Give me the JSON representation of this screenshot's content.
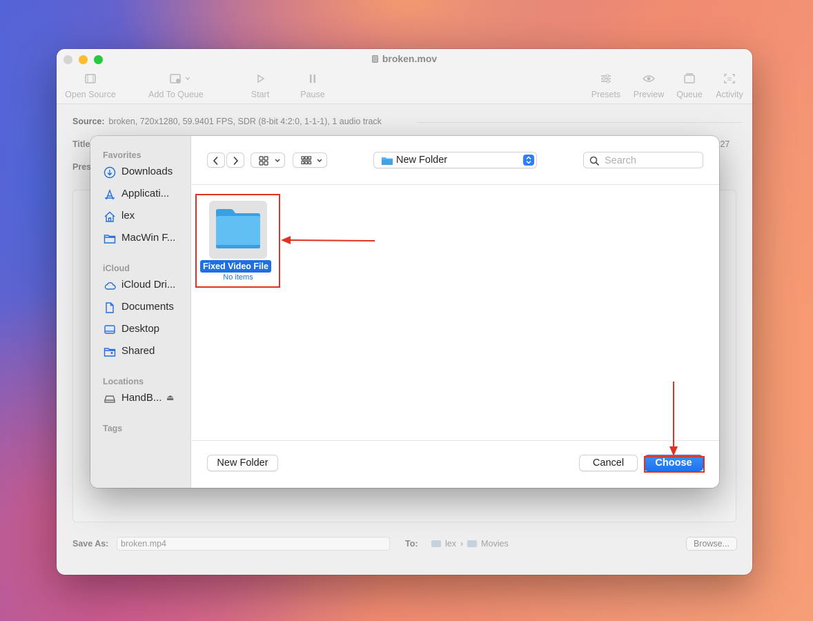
{
  "window": {
    "title": "broken.mov",
    "traffic_colors": [
      "#d4d4d4",
      "#febc2e",
      "#28c840"
    ],
    "toolbar": [
      {
        "label": "Open Source",
        "icon": "film-icon"
      },
      {
        "label": "Add To Queue",
        "icon": "add-queue-icon"
      },
      {
        "label": "Start",
        "icon": "play-icon"
      },
      {
        "label": "Pause",
        "icon": "pause-icon"
      },
      {
        "label": "Presets",
        "icon": "sliders-icon"
      },
      {
        "label": "Preview",
        "icon": "eye-icon"
      },
      {
        "label": "Queue",
        "icon": "queue-icon"
      },
      {
        "label": "Activity",
        "icon": "activity-icon"
      }
    ],
    "source_label": "Source:",
    "source_value": "broken, 720x1280, 59.9401 FPS, SDR (8-bit 4:2:0, 1-1-1), 1 audio track",
    "title_fragment": "Title",
    "presets_fragment": "Pres",
    "time_fragment": ":27",
    "save_as_label": "Save As:",
    "save_as_value": "broken.mp4",
    "to_label": "To:",
    "path": [
      "lex",
      "Movies"
    ],
    "browse_label": "Browse..."
  },
  "dialog": {
    "sidebar": {
      "favorites_head": "Favorites",
      "favorites": [
        {
          "label": "Downloads",
          "icon": "downloads-icon"
        },
        {
          "label": "Applicati...",
          "icon": "applications-icon"
        },
        {
          "label": "lex",
          "icon": "home-icon"
        },
        {
          "label": "MacWin F...",
          "icon": "folder-icon"
        }
      ],
      "icloud_head": "iCloud",
      "icloud": [
        {
          "label": "iCloud Dri...",
          "icon": "cloud-icon"
        },
        {
          "label": "Documents",
          "icon": "document-icon"
        },
        {
          "label": "Desktop",
          "icon": "desktop-icon"
        },
        {
          "label": "Shared",
          "icon": "shared-folder-icon"
        }
      ],
      "locations_head": "Locations",
      "locations": [
        {
          "label": "HandB...",
          "icon": "drive-icon",
          "eject": "⏏"
        }
      ],
      "tags_head": "Tags"
    },
    "location_popup": "New Folder",
    "search_placeholder": "Search",
    "files": [
      {
        "name": "Fixed Video File",
        "subtitle": "No items",
        "selected": true
      }
    ],
    "new_folder_label": "New Folder",
    "cancel_label": "Cancel",
    "choose_label": "Choose"
  },
  "colors": {
    "accent": "#1f6fe0",
    "folder_blue": "#5ab7f0",
    "annotation_red": "#e0321f"
  }
}
